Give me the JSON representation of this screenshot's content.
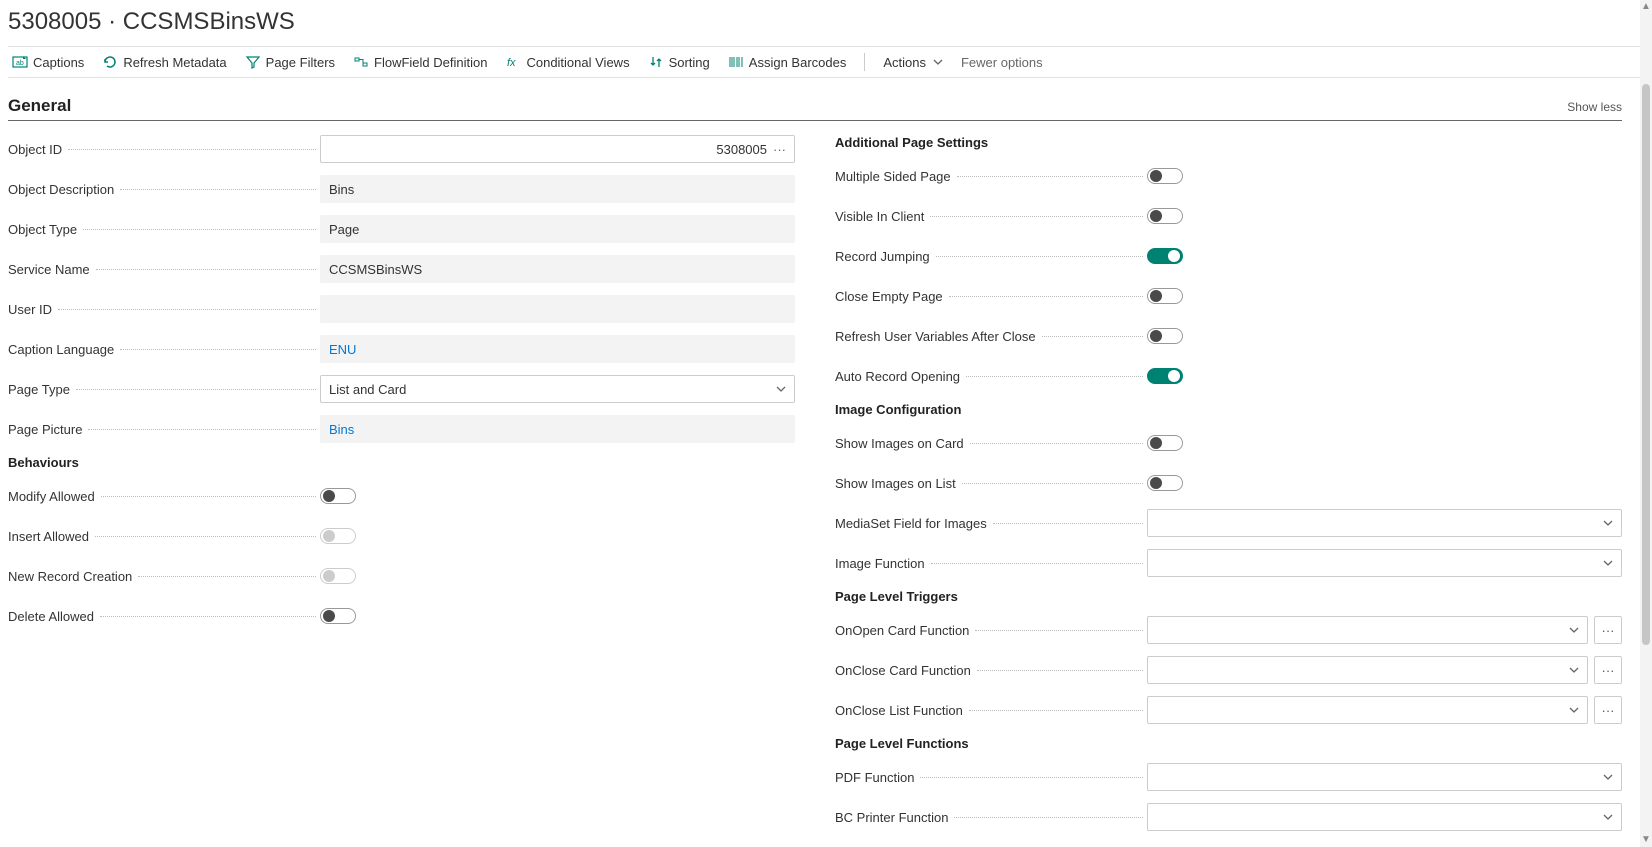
{
  "title_a": "5308005",
  "title_sep": " · ",
  "title_b": "CCSMSBinsWS",
  "toolbar": {
    "captions": "Captions",
    "refresh": "Refresh Metadata",
    "filters": "Page Filters",
    "flowfield": "FlowField Definition",
    "condviews": "Conditional Views",
    "sorting": "Sorting",
    "barcodes": "Assign Barcodes",
    "actions": "Actions",
    "fewer": "Fewer options"
  },
  "section": {
    "general": "General",
    "showless": "Show less"
  },
  "left": {
    "object_id_lbl": "Object ID",
    "object_id_val": "5308005",
    "object_desc_lbl": "Object Description",
    "object_desc_val": "Bins",
    "object_type_lbl": "Object Type",
    "object_type_val": "Page",
    "service_name_lbl": "Service Name",
    "service_name_val": "CCSMSBinsWS",
    "user_id_lbl": "User ID",
    "user_id_val": "",
    "caption_lang_lbl": "Caption Language",
    "caption_lang_val": "ENU",
    "page_type_lbl": "Page Type",
    "page_type_val": "List and Card",
    "page_picture_lbl": "Page Picture",
    "page_picture_val": "Bins",
    "behaviours_hdr": "Behaviours",
    "modify_lbl": "Modify Allowed",
    "insert_lbl": "Insert Allowed",
    "newrec_lbl": "New Record Creation",
    "delete_lbl": "Delete Allowed"
  },
  "right": {
    "addl_hdr": "Additional Page Settings",
    "multiside_lbl": "Multiple Sided Page",
    "visible_lbl": "Visible In Client",
    "recordjump_lbl": "Record Jumping",
    "closeempty_lbl": "Close Empty Page",
    "refreshvars_lbl": "Refresh User Variables After Close",
    "autorec_lbl": "Auto Record Opening",
    "imgconf_hdr": "Image Configuration",
    "showcard_lbl": "Show Images on Card",
    "showlist_lbl": "Show Images on List",
    "mediaset_lbl": "MediaSet Field for Images",
    "imgfunc_lbl": "Image Function",
    "triggers_hdr": "Page Level Triggers",
    "onopencard_lbl": "OnOpen Card Function",
    "onclosecard_lbl": "OnClose Card Function",
    "oncloselist_lbl": "OnClose List Function",
    "funcs_hdr": "Page Level Functions",
    "pdffunc_lbl": "PDF Function",
    "bcprinter_lbl": "BC Printer Function"
  }
}
